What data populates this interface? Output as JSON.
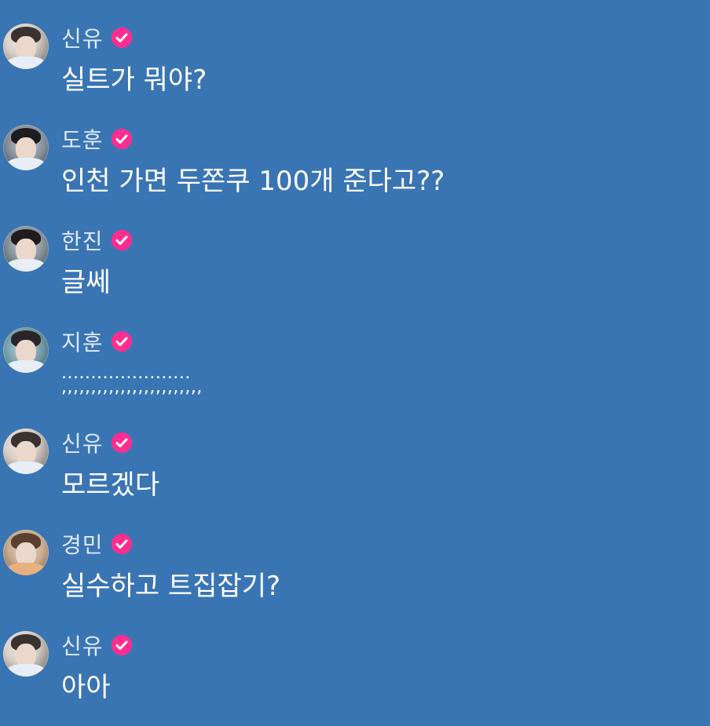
{
  "messages": [
    {
      "name": "신유",
      "text": "실트가 뭐야?",
      "avatar": "avatar-shinyu"
    },
    {
      "name": "도훈",
      "text": "인천 가면 두쫀쿠 100개 준다고??",
      "avatar": "avatar-dohoon"
    },
    {
      "name": "한진",
      "text": "글쎄",
      "avatar": "avatar-hanjin"
    },
    {
      "name": "지훈",
      "text_line1": "......................",
      "text_line2": ",,,,,,,,,,,,,,,,,,,,,,,,",
      "avatar": "avatar-jihoon"
    },
    {
      "name": "신유",
      "text": "모르겠다",
      "avatar": "avatar-shinyu"
    },
    {
      "name": "경민",
      "text": "실수하고 트집잡기?",
      "avatar": "avatar-gyeongmin"
    },
    {
      "name": "신유",
      "text": "아아",
      "avatar": "avatar-shinyu"
    }
  ],
  "colors": {
    "background": "#3a75b3",
    "verified_badge": "#ff2d8f",
    "name_text": "#dfe9f5",
    "message_text": "#ffffff"
  },
  "icons": {
    "verified": "verified-check-icon"
  }
}
